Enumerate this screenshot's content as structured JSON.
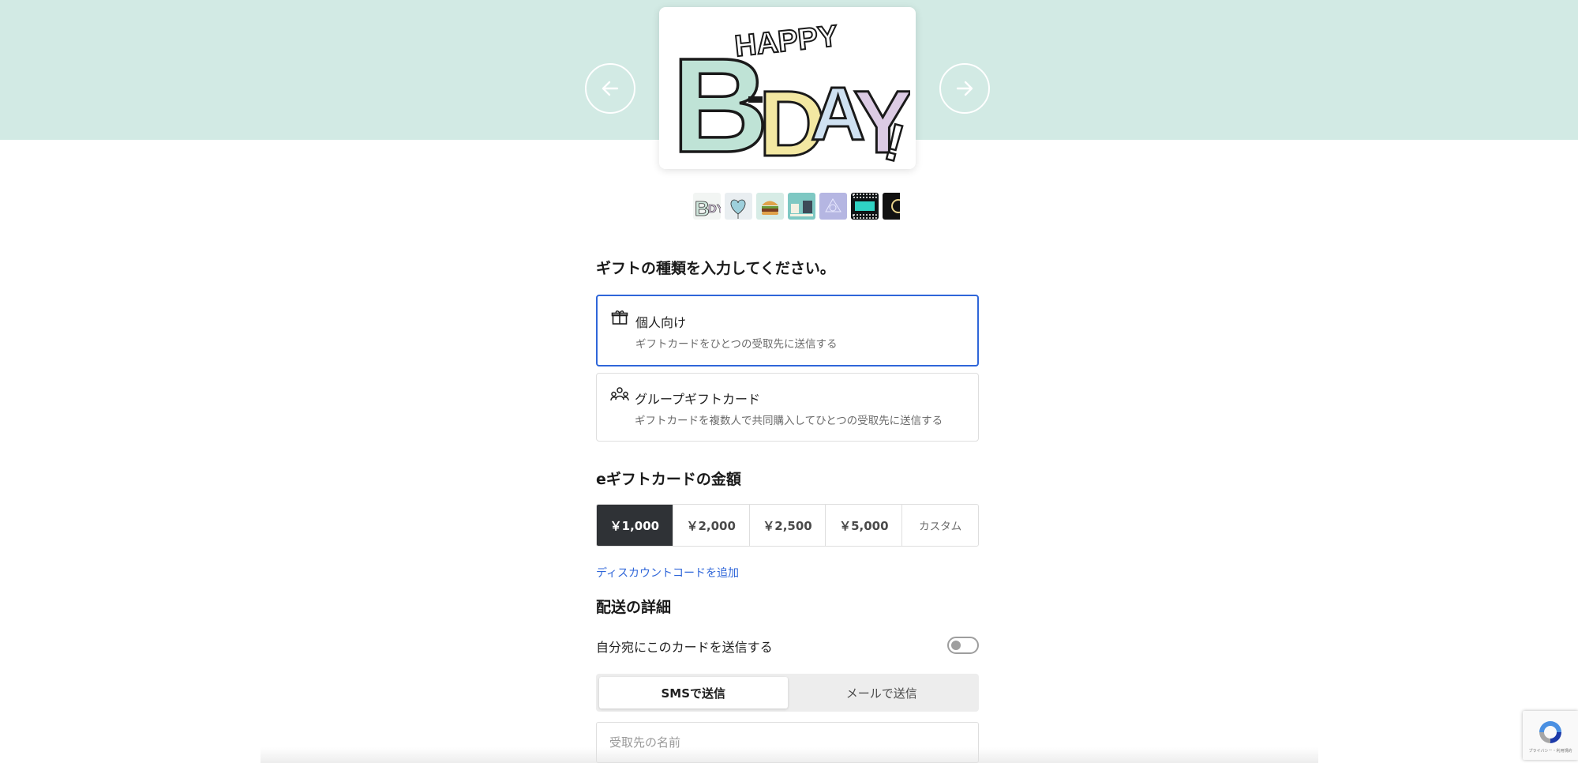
{
  "carousel": {
    "card_text": "HAPPY B-DAY!",
    "thumbnails": [
      {
        "name": "bday-lettering"
      },
      {
        "name": "heart-balloon"
      },
      {
        "name": "burger"
      },
      {
        "name": "teal-gifts"
      },
      {
        "name": "lavender-pattern"
      },
      {
        "name": "black-film"
      },
      {
        "name": "black-gold"
      }
    ]
  },
  "gift_type": {
    "heading": "ギフトの種類を入力してください。",
    "options": [
      {
        "title": "個人向け",
        "description": "ギフトカードをひとつの受取先に送信する",
        "icon": "gift-icon",
        "selected": true
      },
      {
        "title": "グループギフトカード",
        "description": "ギフトカードを複数人で共同購入してひとつの受取先に送信する",
        "icon": "group-icon",
        "selected": false
      }
    ]
  },
  "amount": {
    "heading": "eギフトカードの金額",
    "options": [
      "￥1,000",
      "￥2,000",
      "￥2,500",
      "￥5,000",
      "カスタム"
    ],
    "selected_index": 0
  },
  "discount_link": "ディスカウントコードを追加",
  "delivery": {
    "heading": "配送の詳細",
    "send_to_self_label": "自分宛にこのカードを送信する",
    "send_to_self": false,
    "methods": [
      "SMSで送信",
      "メールで送信"
    ],
    "selected_method": 0,
    "recipient_name_placeholder": "受取先の名前"
  },
  "recaptcha": {
    "footer": "プライバシー・利用規約"
  },
  "colors": {
    "hero_band": "#d2eae4",
    "accent_blue": "#2f66d9",
    "active_amount": "#2f3236"
  }
}
